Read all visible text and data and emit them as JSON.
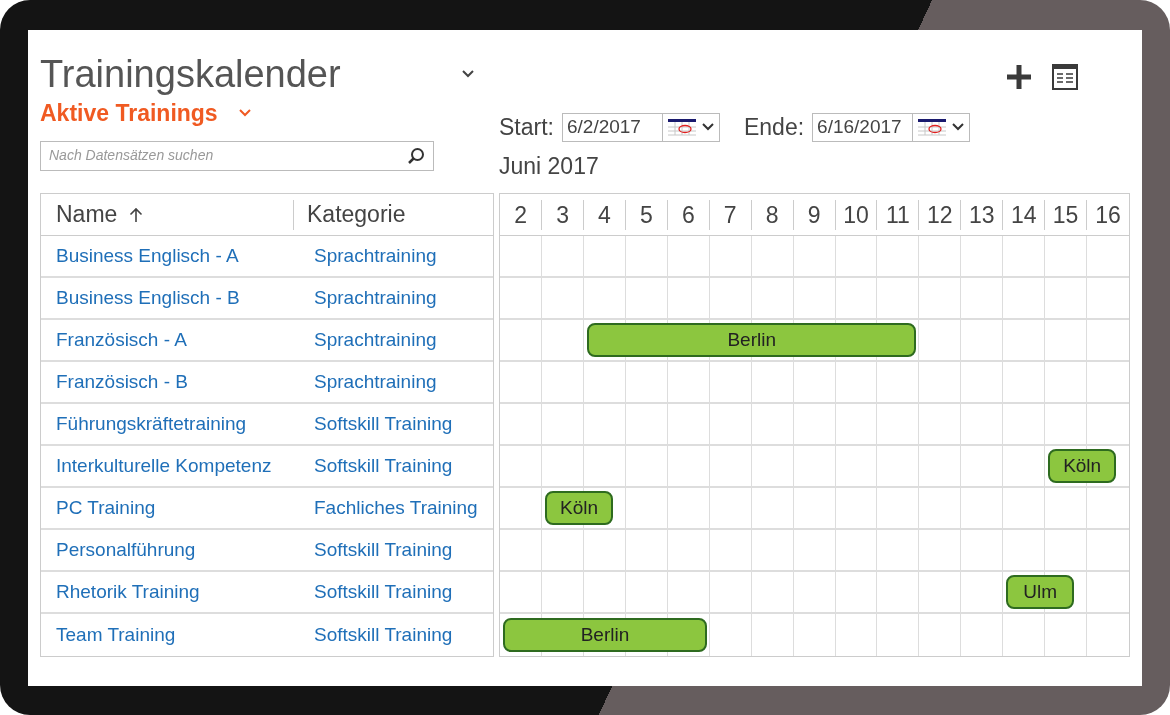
{
  "title": "Trainingskalender",
  "view": "Aktive Trainings",
  "search": {
    "placeholder": "Nach Datensätzen suchen"
  },
  "columns": [
    {
      "label": "Name",
      "sorted": true
    },
    {
      "label": "Kategorie",
      "sorted": false
    }
  ],
  "start": {
    "label": "Start:",
    "value": "6/2/2017"
  },
  "end": {
    "label": "Ende:",
    "value": "6/16/2017"
  },
  "month": "Juni 2017",
  "days": [
    "2",
    "3",
    "4",
    "5",
    "6",
    "7",
    "8",
    "9",
    "10",
    "11",
    "12",
    "13",
    "14",
    "15",
    "16"
  ],
  "rows": [
    {
      "name": "Business Englisch - A",
      "category": "Sprachtraining",
      "timeline": [
        {
          "kind": "free"
        },
        {
          "kind": "free"
        },
        {
          "kind": "free"
        },
        {
          "kind": "free"
        },
        {
          "kind": "free"
        },
        {
          "kind": "free"
        },
        {
          "kind": "free"
        },
        {
          "kind": "free"
        },
        {
          "kind": "free"
        },
        {
          "kind": "free"
        },
        {
          "kind": "free"
        },
        {
          "kind": "free"
        },
        {
          "kind": "free"
        },
        {
          "kind": "free"
        },
        {
          "kind": "free"
        }
      ]
    },
    {
      "name": "Business Englisch - B",
      "category": "Sprachtraining",
      "timeline": [
        {
          "kind": "free"
        },
        {
          "kind": "free"
        },
        {
          "kind": "free"
        },
        {
          "kind": "free"
        },
        {
          "kind": "free"
        },
        {
          "kind": "free"
        },
        {
          "kind": "free"
        },
        {
          "kind": "free"
        },
        {
          "kind": "free"
        },
        {
          "kind": "free"
        },
        {
          "kind": "free"
        },
        {
          "kind": "free"
        },
        {
          "kind": "free"
        },
        {
          "kind": "free"
        },
        {
          "kind": "free"
        }
      ]
    },
    {
      "name": "Französisch - A",
      "category": "Sprachtraining",
      "timeline": [
        {
          "kind": "free"
        },
        {
          "kind": "free"
        },
        {
          "kind": "start",
          "label": "Berlin"
        },
        {
          "kind": "continue"
        },
        {
          "kind": "continue"
        },
        {
          "kind": "continue"
        },
        {
          "kind": "continue"
        },
        {
          "kind": "continue"
        },
        {
          "kind": "continue"
        },
        {
          "kind": "continue"
        },
        {
          "kind": "free"
        },
        {
          "kind": "free"
        },
        {
          "kind": "free"
        },
        {
          "kind": "free"
        },
        {
          "kind": "free"
        }
      ]
    },
    {
      "name": "Französisch - B",
      "category": "Sprachtraining",
      "timeline": [
        {
          "kind": "free"
        },
        {
          "kind": "free"
        },
        {
          "kind": "free"
        },
        {
          "kind": "free"
        },
        {
          "kind": "free"
        },
        {
          "kind": "free"
        },
        {
          "kind": "free"
        },
        {
          "kind": "free"
        },
        {
          "kind": "free"
        },
        {
          "kind": "free"
        },
        {
          "kind": "free"
        },
        {
          "kind": "free"
        },
        {
          "kind": "free"
        },
        {
          "kind": "free"
        },
        {
          "kind": "free"
        }
      ]
    },
    {
      "name": "Führungskräftetraining",
      "category": "Softskill Training",
      "timeline": [
        {
          "kind": "free"
        },
        {
          "kind": "free"
        },
        {
          "kind": "free"
        },
        {
          "kind": "free"
        },
        {
          "kind": "free"
        },
        {
          "kind": "free"
        },
        {
          "kind": "free"
        },
        {
          "kind": "free"
        },
        {
          "kind": "free"
        },
        {
          "kind": "free"
        },
        {
          "kind": "free"
        },
        {
          "kind": "free"
        },
        {
          "kind": "free"
        },
        {
          "kind": "free"
        },
        {
          "kind": "free"
        }
      ]
    },
    {
      "name": "Interkulturelle Kompetenz",
      "category": "Softskill Training",
      "timeline": [
        {
          "kind": "free"
        },
        {
          "kind": "free"
        },
        {
          "kind": "free"
        },
        {
          "kind": "free"
        },
        {
          "kind": "free"
        },
        {
          "kind": "free"
        },
        {
          "kind": "free"
        },
        {
          "kind": "free"
        },
        {
          "kind": "free"
        },
        {
          "kind": "free"
        },
        {
          "kind": "free"
        },
        {
          "kind": "free"
        },
        {
          "kind": "free"
        },
        {
          "kind": "start",
          "label": "Köln"
        },
        {
          "kind": "free"
        }
      ]
    },
    {
      "name": "PC Training",
      "category": "Fachliches Training",
      "timeline": [
        {
          "kind": "free"
        },
        {
          "kind": "start",
          "label": "Köln"
        },
        {
          "kind": "free"
        },
        {
          "kind": "free"
        },
        {
          "kind": "free"
        },
        {
          "kind": "free"
        },
        {
          "kind": "free"
        },
        {
          "kind": "free"
        },
        {
          "kind": "free"
        },
        {
          "kind": "free"
        },
        {
          "kind": "free"
        },
        {
          "kind": "free"
        },
        {
          "kind": "free"
        },
        {
          "kind": "free"
        },
        {
          "kind": "free"
        }
      ]
    },
    {
      "name": "Personalführung",
      "category": "Softskill Training",
      "timeline": [
        {
          "kind": "free"
        },
        {
          "kind": "free"
        },
        {
          "kind": "free"
        },
        {
          "kind": "free"
        },
        {
          "kind": "free"
        },
        {
          "kind": "free"
        },
        {
          "kind": "free"
        },
        {
          "kind": "free"
        },
        {
          "kind": "free"
        },
        {
          "kind": "free"
        },
        {
          "kind": "free"
        },
        {
          "kind": "free"
        },
        {
          "kind": "free"
        },
        {
          "kind": "free"
        },
        {
          "kind": "free"
        }
      ]
    },
    {
      "name": "Rhetorik Training",
      "category": "Softskill Training",
      "timeline": [
        {
          "kind": "free"
        },
        {
          "kind": "free"
        },
        {
          "kind": "free"
        },
        {
          "kind": "free"
        },
        {
          "kind": "free"
        },
        {
          "kind": "free"
        },
        {
          "kind": "free"
        },
        {
          "kind": "free"
        },
        {
          "kind": "free"
        },
        {
          "kind": "free"
        },
        {
          "kind": "free"
        },
        {
          "kind": "free"
        },
        {
          "kind": "start",
          "label": "Ulm"
        },
        {
          "kind": "free"
        },
        {
          "kind": "free"
        }
      ]
    },
    {
      "name": "Team Training",
      "category": "Softskill Training",
      "timeline": [
        {
          "kind": "start",
          "label": "Berlin"
        },
        {
          "kind": "continue"
        },
        {
          "kind": "continue"
        },
        {
          "kind": "continue"
        },
        {
          "kind": "continue"
        },
        {
          "kind": "free"
        },
        {
          "kind": "free"
        },
        {
          "kind": "free"
        },
        {
          "kind": "free"
        },
        {
          "kind": "free"
        },
        {
          "kind": "free"
        },
        {
          "kind": "free"
        },
        {
          "kind": "free"
        },
        {
          "kind": "free"
        },
        {
          "kind": "free"
        }
      ]
    }
  ]
}
